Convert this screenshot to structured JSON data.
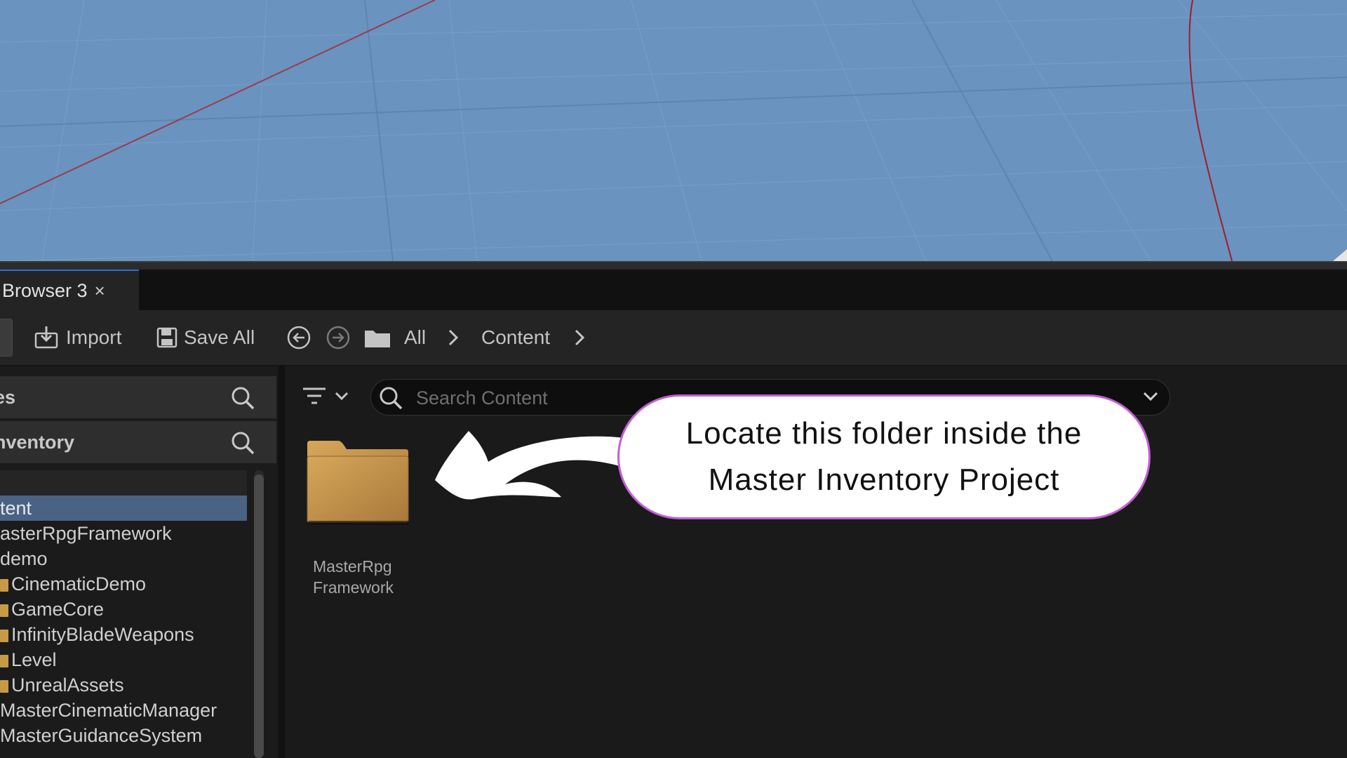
{
  "tab": {
    "title": "Browser 3",
    "close_glyph": "×"
  },
  "toolbar": {
    "import_label": "Import",
    "save_all_label": "Save All",
    "breadcrumb": [
      "All",
      "Content"
    ]
  },
  "left_panel": {
    "favorites_header": "es",
    "project_header": "nventory",
    "tree_items": [
      {
        "label": "",
        "folder_icon": false
      },
      {
        "label": "tent",
        "folder_icon": false,
        "selected": true
      },
      {
        "label": "asterRpgFramework",
        "folder_icon": false
      },
      {
        "label": "demo",
        "folder_icon": false
      },
      {
        "label": "CinematicDemo",
        "folder_icon": true
      },
      {
        "label": "GameCore",
        "folder_icon": true
      },
      {
        "label": "InfinityBladeWeapons",
        "folder_icon": true
      },
      {
        "label": "Level",
        "folder_icon": true
      },
      {
        "label": "UnrealAssets",
        "folder_icon": true
      },
      {
        "label": "MasterCinematicManager",
        "folder_icon": false
      },
      {
        "label": "MasterGuidanceSystem",
        "folder_icon": false
      }
    ]
  },
  "search": {
    "placeholder": "Search Content",
    "value": ""
  },
  "content": {
    "folders": [
      {
        "name_line1": "MasterRpg",
        "name_line2": "Framework"
      }
    ]
  },
  "callout": {
    "text": "Locate this folder inside the Master Inventory Project"
  },
  "colors": {
    "viewport_bg": "#6a93bf",
    "folder": "#c79a48",
    "selection": "#4a6284",
    "callout_border": "#c45fd6"
  }
}
